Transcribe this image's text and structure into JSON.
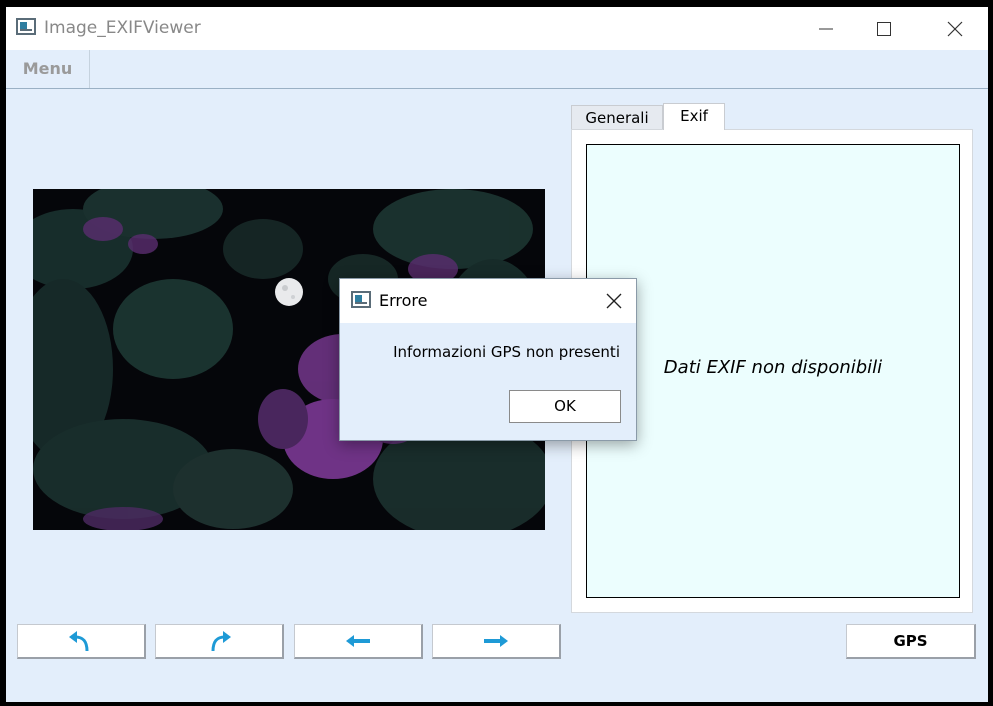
{
  "window": {
    "title": "Image_EXIFViewer"
  },
  "menu": {
    "label": "Menu"
  },
  "tabs": [
    {
      "label": "Generali",
      "active": false
    },
    {
      "label": "Exif",
      "active": true
    }
  ],
  "exif": {
    "message": "Dati EXIF non disponibili"
  },
  "nav": {
    "buttons": [
      {
        "icon": "undo-arrow-icon"
      },
      {
        "icon": "redo-arrow-icon"
      },
      {
        "icon": "arrow-left-icon"
      },
      {
        "icon": "arrow-right-icon"
      }
    ]
  },
  "gps": {
    "label": "GPS"
  },
  "dialog": {
    "title": "Errore",
    "message": "Informazioni GPS non presenti",
    "ok_label": "OK"
  },
  "colors": {
    "accent": "#1e9ad6",
    "background": "#e3eefb",
    "exif_panel": "#ecfefe"
  }
}
